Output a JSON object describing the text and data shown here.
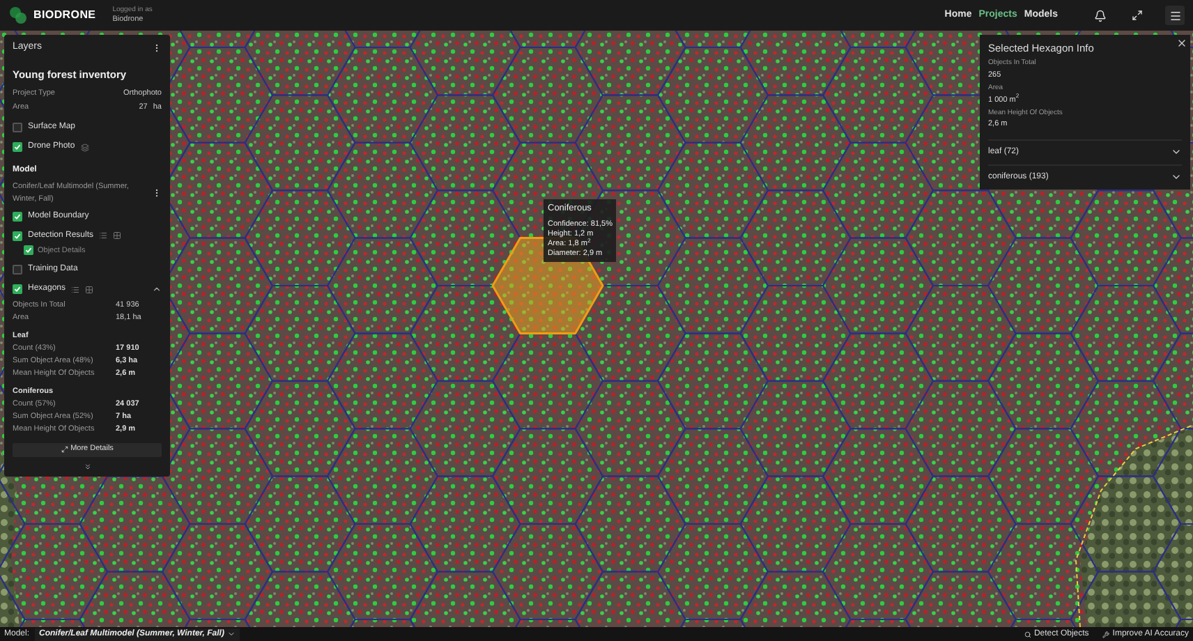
{
  "header": {
    "logo": "BIODRONE",
    "login_label": "Logged in as",
    "user": "Biodrone",
    "nav": [
      {
        "label": "Home",
        "selected": false
      },
      {
        "label": "Projects",
        "selected": true
      },
      {
        "label": "Models",
        "selected": false
      }
    ]
  },
  "layers_panel": {
    "title": "Layers",
    "project_name": "Young forest inventory",
    "fields": [
      {
        "label": "Project Type",
        "value": "Orthophoto"
      },
      {
        "label": "Area",
        "value": "27",
        "unit": "ha"
      }
    ],
    "layers": [
      {
        "label": "Surface Map",
        "checked": false
      },
      {
        "label": "Drone Photo",
        "checked": true
      }
    ],
    "model_heading": "Model",
    "model_name": "Conifer/Leaf Multimodel (Summer, Winter, Fall)",
    "model_layers": [
      {
        "label": "Model Boundary",
        "checked": true
      },
      {
        "label": "Detection Results",
        "checked": true,
        "children": [
          {
            "label": "Object Details",
            "checked": true
          }
        ]
      },
      {
        "label": "Training Data",
        "checked": false
      },
      {
        "label": "Hexagons",
        "checked": true
      }
    ],
    "totals": [
      {
        "label": "Objects In Total",
        "value": "41 936"
      },
      {
        "label": "Area",
        "value": "18,1 ha"
      }
    ],
    "groups": [
      {
        "name": "Leaf",
        "rows": [
          {
            "label": "Count (43%)",
            "value": "17 910"
          },
          {
            "label": "Sum Object Area (48%)",
            "value": "6,3 ha"
          },
          {
            "label": "Mean Height Of Objects",
            "value": "2,6 m"
          }
        ]
      },
      {
        "name": "Coniferous",
        "rows": [
          {
            "label": "Count (57%)",
            "value": "24 037"
          },
          {
            "label": "Sum Object Area (52%)",
            "value": "7 ha"
          },
          {
            "label": "Mean Height Of Objects",
            "value": "2,9 m"
          }
        ]
      }
    ],
    "more_button": "More Details"
  },
  "tooltip": {
    "title": "Coniferous",
    "lines": [
      "Confidence: 81,5%",
      "Height: 1,2 m",
      "Area: 1,8 m$^{2}$",
      "Diameter: 2,9 m"
    ]
  },
  "hexagon_panel": {
    "title": "Selected Hexagon Info",
    "stats": [
      {
        "label": "Objects In Total",
        "value": "265"
      },
      {
        "label": "Area",
        "value": "1 000 m$^{2}$"
      },
      {
        "label": "Mean Height Of Objects",
        "value": "2,6 m"
      }
    ],
    "sections": [
      {
        "label": "leaf (72)",
        "expanded": false
      },
      {
        "label": "coniferous (193)",
        "expanded": false
      }
    ]
  },
  "bottom_bar": {
    "model_label": "Model:",
    "model_name": "Conifer/Leaf Multimodel (Summer, Winter, Fall)",
    "actions": [
      "Detect Objects",
      "Improve AI Accuracy"
    ]
  }
}
